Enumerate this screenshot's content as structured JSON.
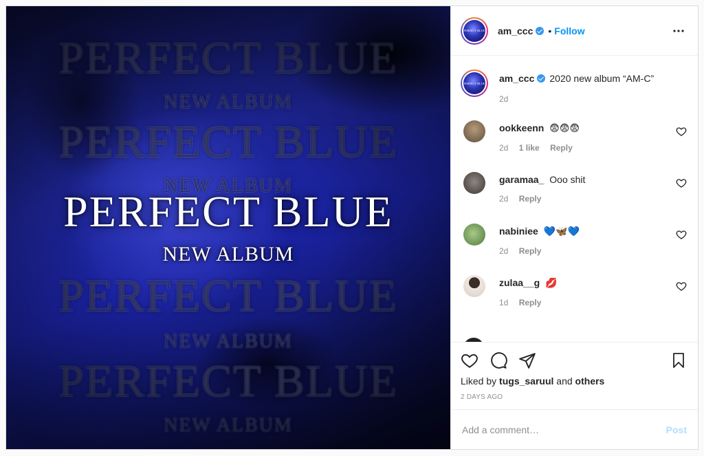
{
  "media": {
    "title": "PERFECT BLUE",
    "subtitle": "NEW ALBUM",
    "background_colors": [
      "#1d2597",
      "#0b0f45",
      "#05061d"
    ]
  },
  "header": {
    "avatar_text": "PERFECT BLUE",
    "username": "am_ccc",
    "separator": "•",
    "follow_label": "Follow",
    "more_icon": "more-horizontal-icon"
  },
  "caption": {
    "username": "am_ccc",
    "text": "2020 new album “AM-C”",
    "time": "2d"
  },
  "comments": [
    {
      "username": "ookkeenn",
      "text": "😨😨😨",
      "time": "2d",
      "likes": "1 like",
      "reply": "Reply",
      "avatar_color": "#7a6a58"
    },
    {
      "username": "garamaa_",
      "text": "Ooo shit",
      "time": "2d",
      "likes": "",
      "reply": "Reply",
      "avatar_color": "#5a5450"
    },
    {
      "username": "nabiniee",
      "text": "💙🦋💙",
      "time": "2d",
      "likes": "",
      "reply": "Reply",
      "avatar_color": "#6f9a5a"
    },
    {
      "username": "zulaa__g",
      "text": "💋",
      "time": "1d",
      "likes": "",
      "reply": "Reply",
      "avatar_color": "#d9cfc8"
    }
  ],
  "actions": {
    "like_icon": "heart-icon",
    "comment_icon": "comment-icon",
    "share_icon": "paper-plane-icon",
    "save_icon": "bookmark-icon",
    "liked_by_prefix": "Liked by",
    "liked_by_user": "tugs_saruul",
    "liked_by_and": "and",
    "liked_by_others": "others",
    "timestamp": "2 DAYS AGO"
  },
  "add_comment": {
    "placeholder": "Add a comment…",
    "post_label": "Post"
  },
  "colors": {
    "accent": "#0095f6",
    "verified": "#3897f0",
    "muted": "#8e8e8e",
    "post_disabled": "#b2dffc"
  }
}
